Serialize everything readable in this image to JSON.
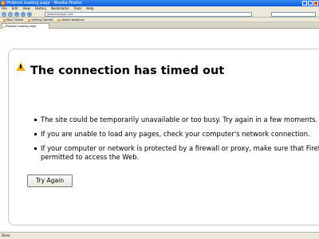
{
  "window": {
    "title": "Problem loading page - Mozilla Firefox"
  },
  "menu": [
    "File",
    "Edit",
    "View",
    "History",
    "Bookmarks",
    "Tools",
    "Help"
  ],
  "nav": {
    "url": "www.example.com"
  },
  "bookmarks": [
    "Most Visited",
    "Getting Started",
    "Latest Headlines"
  ],
  "tab": {
    "label": "Problem loading page"
  },
  "error": {
    "title": "The connection has timed out",
    "items": [
      "The site could be temporarily unavailable or too busy. Try again in a few moments.",
      "If you are unable to load any pages, check your computer's network connection.",
      "If your computer or network is protected by a firewall or proxy, make sure that Firefox",
      "permitted to access the Web."
    ],
    "button": "Try Again"
  },
  "status": {
    "text": "Done"
  },
  "colors": {
    "titlebar": "#0a5ad8",
    "warning": "#e6b918"
  }
}
